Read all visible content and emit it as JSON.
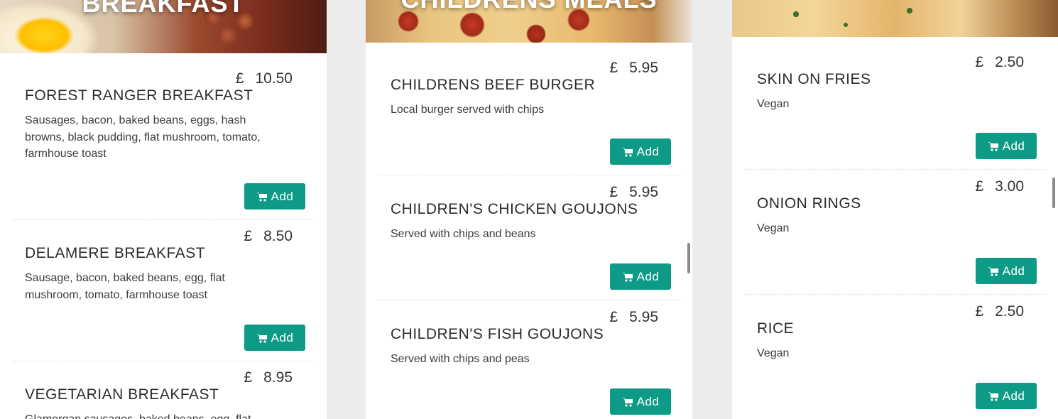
{
  "columns": [
    {
      "banner_title": "BREAKFAST",
      "items": [
        {
          "currency": "£",
          "price": "10.50",
          "name": "FOREST RANGER BREAKFAST",
          "description": "Sausages, bacon, baked beans, eggs, hash browns, black pudding, flat mushroom, tomato, farmhouse toast",
          "add_label": "Add"
        },
        {
          "currency": "£",
          "price": "8.50",
          "name": "DELAMERE BREAKFAST",
          "description": "Sausage, bacon, baked beans, egg, flat mushroom, tomato, farmhouse toast",
          "add_label": "Add"
        },
        {
          "currency": "£",
          "price": "8.95",
          "name": "VEGETARIAN BREAKFAST",
          "description": "Glamorgan sausages, baked beans, egg, flat",
          "add_label": "Add"
        }
      ]
    },
    {
      "banner_title": "CHILDRENS MEALS",
      "items": [
        {
          "currency": "£",
          "price": "5.95",
          "name": "CHILDRENS BEEF BURGER",
          "description": "Local burger served with chips",
          "add_label": "Add"
        },
        {
          "currency": "£",
          "price": "5.95",
          "name": "CHILDREN'S CHICKEN GOUJONS",
          "description": "Served with chips and beans",
          "add_label": "Add"
        },
        {
          "currency": "£",
          "price": "5.95",
          "name": "CHILDREN'S FISH GOUJONS",
          "description": "Served with chips and peas",
          "add_label": "Add"
        }
      ]
    },
    {
      "banner_title": "",
      "items": [
        {
          "currency": "£",
          "price": "2.50",
          "name": "SKIN ON FRIES",
          "description": "Vegan",
          "add_label": "Add"
        },
        {
          "currency": "£",
          "price": "3.00",
          "name": "ONION RINGS",
          "description": "Vegan",
          "add_label": "Add"
        },
        {
          "currency": "£",
          "price": "2.50",
          "name": "RICE",
          "description": "Vegan",
          "add_label": "Add"
        }
      ]
    }
  ],
  "icons": {
    "cart": "shopping-cart-icon"
  },
  "colors": {
    "add_button": "#0d9a86",
    "page_background": "#ececec",
    "card": "#ffffff"
  }
}
